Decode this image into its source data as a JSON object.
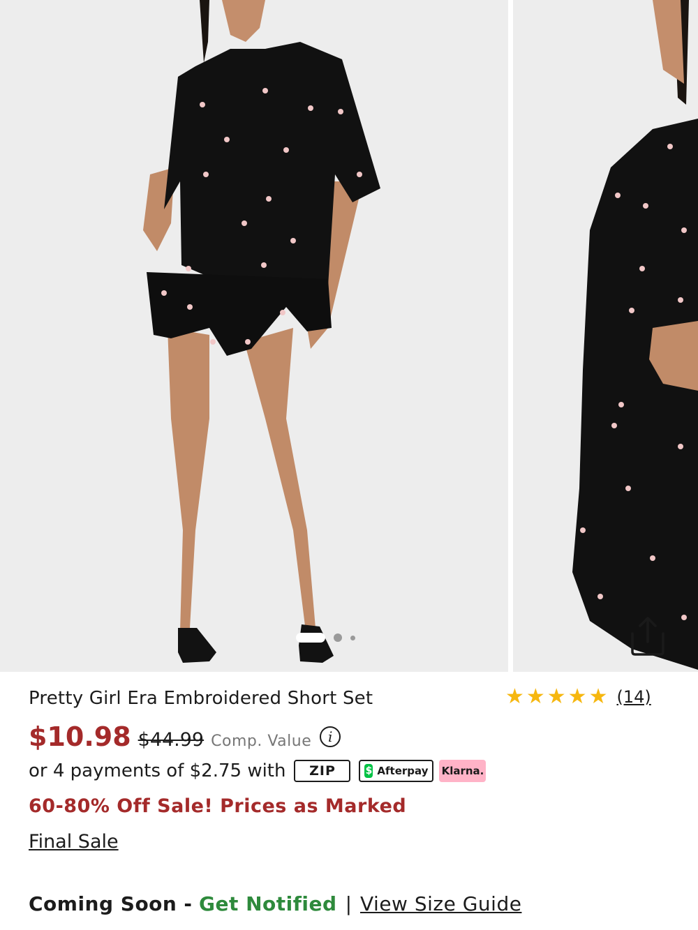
{
  "product": {
    "title": "Pretty Girl Era Embroidered Short Set",
    "rating_stars": "★★★★★",
    "rating_value": 5,
    "review_count": "(14)",
    "sale_price": "$10.98",
    "original_price": "$44.99",
    "comp_value_label": "Comp. Value",
    "info_icon_glyph": "i"
  },
  "gallery": {
    "image_count": 3,
    "active_index": 0,
    "image_alt_1": "Model wearing black embroidered shirt and shorts, front view",
    "image_alt_2": "Model wearing black embroidered set, side view"
  },
  "payments": {
    "text": "or 4 payments of $2.75 with",
    "zip_label": "ZIP",
    "afterpay_label": "Afterpay",
    "afterpay_icon": "$",
    "klarna_label": "Klarna."
  },
  "promo": {
    "text": "60-80% Off Sale! Prices as Marked",
    "final_sale": "Final Sale"
  },
  "availability": {
    "status": "Coming Soon",
    "dash": "-",
    "notify": "Get Notified",
    "separator": "|",
    "size_guide": "View Size Guide"
  },
  "colors": {
    "sale_red": "#a42a2a",
    "notify_green": "#2e8a3c",
    "star_gold": "#f6b70f",
    "klarna_pink": "#ffb3c7",
    "afterpay_green": "#00c244"
  }
}
